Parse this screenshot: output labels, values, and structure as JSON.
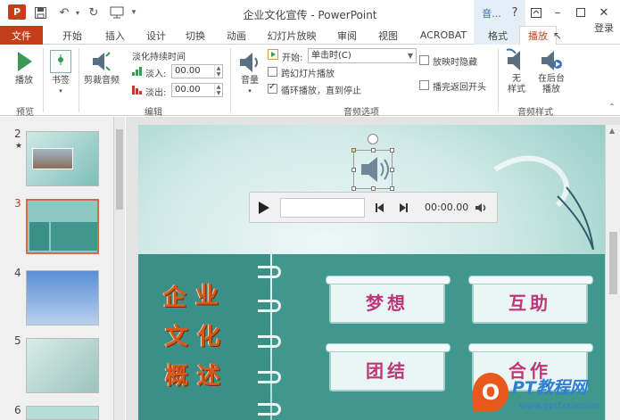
{
  "window": {
    "title": "企业文化宣传 - PowerPoint",
    "context_group": "音...",
    "help": "?",
    "login": "登录"
  },
  "qat": {
    "logo": "P",
    "more": "▾"
  },
  "tabs": [
    "文件",
    "开始",
    "插入",
    "设计",
    "切换",
    "动画",
    "幻灯片放映",
    "审阅",
    "视图",
    "ACROBAT",
    "格式",
    "播放"
  ],
  "active_tab": "播放",
  "ribbon": {
    "preview": {
      "play_label": "播放",
      "group": "预览"
    },
    "bookmarks": {
      "label": "书签"
    },
    "edit": {
      "trim_label": "剪裁音频",
      "fade_title": "淡化持续时间",
      "fade_in_label": "淡入:",
      "fade_in_value": "00.00",
      "fade_out_label": "淡出:",
      "fade_out_value": "00.00",
      "group": "编辑"
    },
    "audio_options": {
      "volume_label": "音量",
      "start_label": "开始:",
      "start_value": "单击时(C)",
      "cross_slides": "跨幻灯片播放",
      "loop": "循环播放，直到停止",
      "hide_during_show": "放映时隐藏",
      "rewind": "播完返回开头",
      "group": "音频选项",
      "cross_slides_checked": false,
      "loop_checked": true,
      "hide_checked": false,
      "rewind_checked": false
    },
    "audio_styles": {
      "no_style": "无\n样式",
      "background": "在后台\n播放",
      "group": "音频样式"
    }
  },
  "slides": [
    {
      "num": "2",
      "star": "★"
    },
    {
      "num": "3"
    },
    {
      "num": "4"
    },
    {
      "num": "5"
    },
    {
      "num": "6"
    }
  ],
  "selected_slide": "3",
  "slide_content": {
    "title_chars": [
      "企",
      "业",
      "文",
      "化",
      "概",
      "述"
    ],
    "boxes": [
      "梦想",
      "互助",
      "团结",
      "合作"
    ]
  },
  "player": {
    "time": "00:00.00"
  },
  "watermark": {
    "logo": "O",
    "name": "PT教程网",
    "url": "www.pptfxxw.com"
  },
  "colors": {
    "accent": "#c43e1c",
    "context_tab": "#e4eef7",
    "slide_teal": "#3f978d"
  }
}
